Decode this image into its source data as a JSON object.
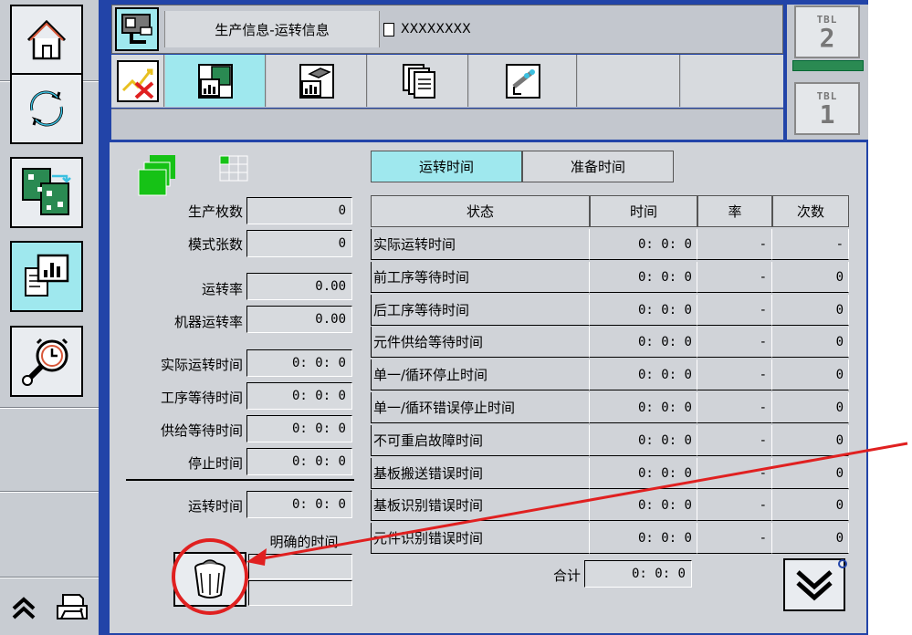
{
  "header": {
    "title": "生产信息-运转信息",
    "file_name": "XXXXXXXX"
  },
  "table_switch": {
    "top_label": "TBL",
    "top_number": "2",
    "bottom_label": "TBL",
    "bottom_number": "1"
  },
  "tabs": {
    "run_time": "运转时间",
    "prep_time": "准备时间"
  },
  "left_panel": {
    "rows": [
      {
        "label": "生产枚数",
        "value": "0"
      },
      {
        "label": "模式张数",
        "value": "0"
      },
      {
        "label": "运转率",
        "value": "0.00"
      },
      {
        "label": "机器运转率",
        "value": "0.00"
      },
      {
        "label": "实际运转时间",
        "value": "0: 0: 0"
      },
      {
        "label": "工序等待时间",
        "value": "0: 0: 0"
      },
      {
        "label": "供给等待时间",
        "value": "0: 0: 0"
      },
      {
        "label": "停止时间",
        "value": "0: 0: 0"
      },
      {
        "label": "运转时间",
        "value": "0: 0: 0"
      }
    ],
    "clear_time_label": "明确的时间",
    "clear_time_value": ""
  },
  "table": {
    "headers": [
      "状态",
      "时间",
      "率",
      "次数"
    ],
    "rows": [
      {
        "status": "实际运转时间",
        "time": "0: 0: 0",
        "rate": "-",
        "count": "-"
      },
      {
        "status": "前工序等待时间",
        "time": "0: 0: 0",
        "rate": "-",
        "count": "0"
      },
      {
        "status": "后工序等待时间",
        "time": "0: 0: 0",
        "rate": "-",
        "count": "0"
      },
      {
        "status": "元件供给等待时间",
        "time": "0: 0: 0",
        "rate": "-",
        "count": "0"
      },
      {
        "status": "单一/循环停止时间",
        "time": "0: 0: 0",
        "rate": "-",
        "count": "0"
      },
      {
        "status": "单一/循环错误停止时间",
        "time": "0: 0: 0",
        "rate": "-",
        "count": "0"
      },
      {
        "status": "不可重启故障时间",
        "time": "0: 0: 0",
        "rate": "-",
        "count": "0"
      },
      {
        "status": "基板搬送错误时间",
        "time": "0: 0: 0",
        "rate": "-",
        "count": "0"
      },
      {
        "status": "基板识别错误时间",
        "time": "0: 0: 0",
        "rate": "-",
        "count": "0"
      },
      {
        "status": "元件识别错误时间",
        "time": "0: 0: 0",
        "rate": "-",
        "count": "0"
      }
    ],
    "total_label": "合计",
    "total_value": "0: 0: 0"
  },
  "colors": {
    "blue": "#2244a8",
    "active": "#9fe8ee",
    "annotation": "#e02020"
  }
}
